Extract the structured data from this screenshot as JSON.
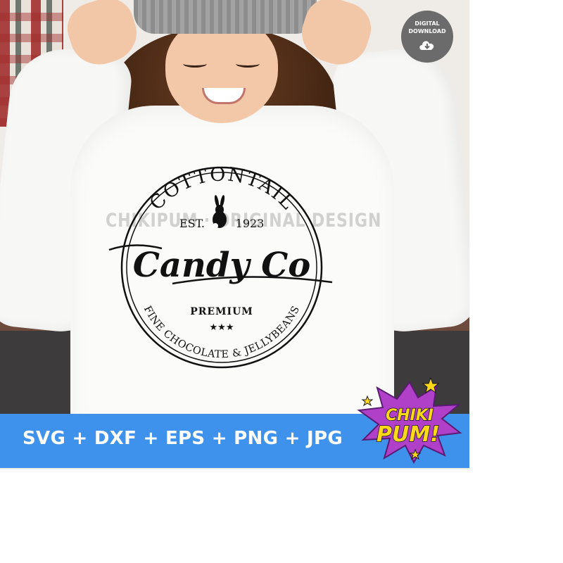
{
  "badge": {
    "line1": "DIGITAL",
    "line2": "DOWNLOAD",
    "icon": "cloud-download-icon"
  },
  "logo": {
    "arc_top": "COTTONTAIL",
    "est": "EST. 1923",
    "script": "Candy Co",
    "premium": "PREMIUM",
    "stars": "★★★",
    "arc_bottom": "FINE CHOCOLATE & JELLYBEANS",
    "icon": "bunny-icon"
  },
  "watermark": "CHIKIPUM · ORIGINAL DESIGN",
  "banner": {
    "formats": "SVG + DXF + EPS + PNG + JPG"
  },
  "brand": {
    "line1": "CHIKI",
    "line2": "PUM!"
  },
  "colors": {
    "banner": "#3f92ec",
    "badge": "#6b6b6b",
    "burst": "#b040c8",
    "brand_text": "#ffd81a"
  }
}
